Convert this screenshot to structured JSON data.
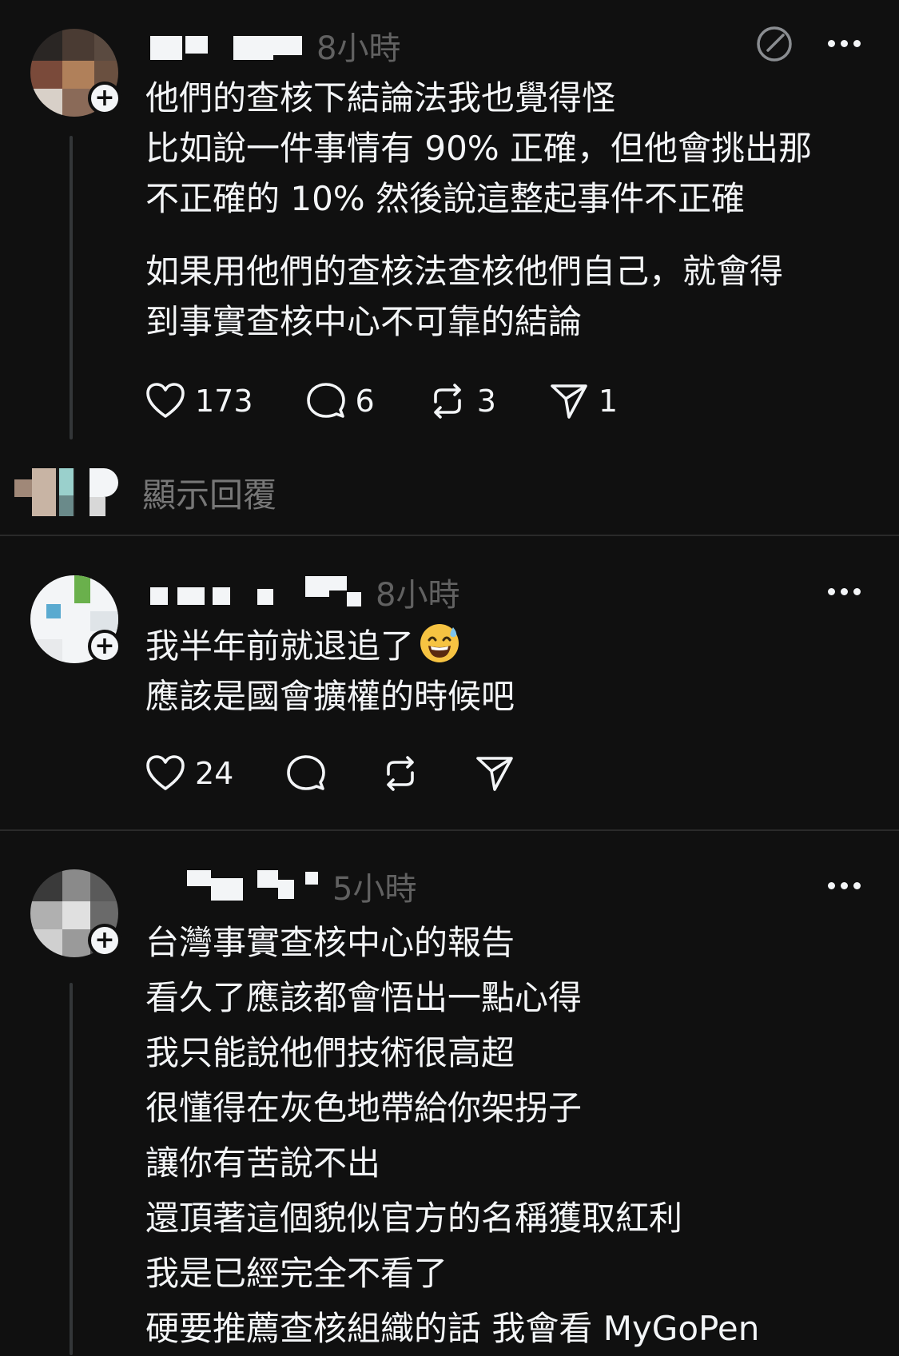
{
  "colors": {
    "background": "#101010",
    "text_primary": "#f3f5f7",
    "text_secondary": "#616161",
    "divider": "#2a2a2a"
  },
  "posts": [
    {
      "timestamp": "8小時",
      "lines_a": [
        "他們的查核下結論法我也覺得怪",
        "比如說一件事情有 90% 正確，但他會挑出那",
        "不正確的 10% 然後說這整起事件不正確"
      ],
      "lines_b": [
        "如果用他們的查核法查核他們自己，就會得",
        "到事實查核中心不可靠的結論"
      ],
      "likes": "173",
      "comments": "6",
      "reposts": "3",
      "shares": "1",
      "show_replies_label": "顯示回覆"
    },
    {
      "timestamp": "8小時",
      "lines": [
        "我半年前就退追了",
        "應該是國會擴權的時候吧"
      ],
      "likes": "24"
    },
    {
      "timestamp": "5小時",
      "lines": [
        "台灣事實查核中心的報告",
        "看久了應該都會悟出一點心得",
        "我只能說他們技術很高超",
        "很懂得在灰色地帶給你架拐子",
        "讓你有苦說不出",
        "還頂著這個貌似官方的名稱獲取紅利",
        "我是已經完全不看了",
        "硬要推薦查核組織的話 我會看 MyGoPen"
      ]
    }
  ]
}
